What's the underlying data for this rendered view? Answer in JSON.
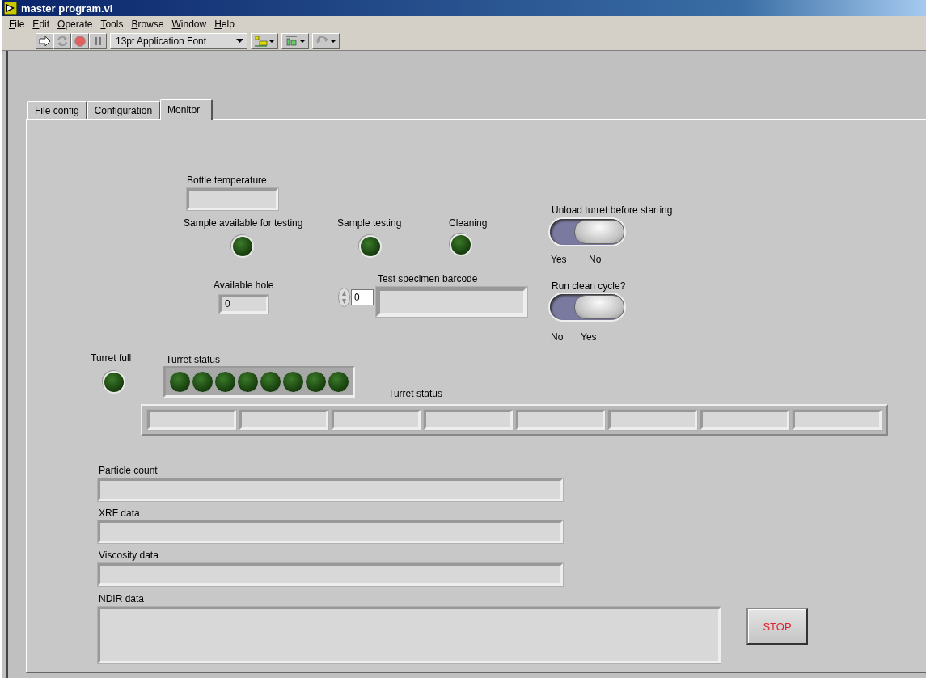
{
  "window": {
    "title": "master program.vi"
  },
  "menu": [
    "File",
    "Edit",
    "Operate",
    "Tools",
    "Browse",
    "Window",
    "Help"
  ],
  "toolbar": {
    "font": "13pt Application Font"
  },
  "tabs": [
    {
      "label": "File config",
      "selected": false
    },
    {
      "label": "Configuration",
      "selected": false
    },
    {
      "label": "Monitor",
      "selected": true
    }
  ],
  "bottle_temperature": {
    "label": "Bottle temperature"
  },
  "leds": [
    {
      "label": "Sample available for testing",
      "on": false
    },
    {
      "label": "Sample testing",
      "on": false
    },
    {
      "label": "Cleaning",
      "on": false
    }
  ],
  "switches": [
    {
      "label": "Unload turret before starting",
      "options": [
        "Yes",
        "No"
      ],
      "on": true
    },
    {
      "label": "Run clean cycle?",
      "options": [
        "No",
        "Yes"
      ],
      "on": true
    }
  ],
  "available_hole": {
    "label": "Available hole",
    "value": "0"
  },
  "barcode": {
    "label": "Test specimen barcode",
    "index": "0"
  },
  "turret_full": {
    "label": "Turret full",
    "on": false
  },
  "turret_leds": {
    "label": "Turret status",
    "leds": [
      {
        "on": false
      },
      {
        "on": false
      },
      {
        "on": false
      },
      {
        "on": false
      },
      {
        "on": false
      },
      {
        "on": false
      },
      {
        "on": false
      },
      {
        "on": false
      }
    ]
  },
  "turret_status": {
    "label": "Turret status",
    "cells": [
      {
        "kind": "string"
      },
      {
        "kind": "string"
      },
      {
        "kind": "string"
      },
      {
        "kind": "string"
      },
      {
        "kind": "string"
      },
      {
        "kind": "string"
      },
      {
        "kind": "string"
      },
      {
        "kind": "string"
      }
    ]
  },
  "text_displays": [
    {
      "label": "Particle count",
      "kind": "single"
    },
    {
      "label": "XRF data",
      "kind": "single"
    },
    {
      "label": "Viscosity data",
      "kind": "single"
    },
    {
      "label": "NDIR data",
      "kind": "multi"
    }
  ],
  "stop_button": {
    "label": "STOP"
  }
}
